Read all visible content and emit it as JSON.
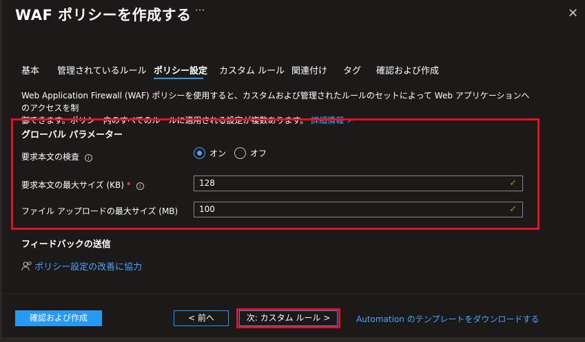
{
  "header": {
    "title": "WAF ポリシーを作成する",
    "more": "···",
    "close": "✕"
  },
  "tabs": [
    {
      "label": "基本",
      "active": false
    },
    {
      "label": "管理されているルール",
      "active": false
    },
    {
      "label": "ポリシー設定",
      "active": true
    },
    {
      "label": "カスタム ルール",
      "active": false
    },
    {
      "label": "関連付け",
      "active": false
    },
    {
      "label": "タグ",
      "active": false
    },
    {
      "label": "確認および作成",
      "active": false
    }
  ],
  "description": {
    "line1": "Web Application Firewall (WAF) ポリシーを使用すると、カスタムおよび管理されたルールのセットによって Web アプリケーションへのアクセスを制",
    "line2": "御できます。ポリシー内のすべてのルールに適用される設定が複数あります。",
    "link": "詳細情報",
    "link_icon": "↗"
  },
  "global_params": {
    "title": "グローバル パラメーター",
    "body_inspection_label": "要求本文の検査",
    "radio_on": "オン",
    "radio_off": "オフ",
    "selected": "オン",
    "max_body_label": "要求本文の最大サイズ (KB)",
    "required_mark": "*",
    "max_body_value": "128",
    "max_upload_label": "ファイル アップロードの最大サイズ (MB)",
    "max_upload_value": "100",
    "check": "✓",
    "info": "i"
  },
  "feedback": {
    "title": "フィードバックの送信",
    "link": "ポリシー設定の改善に協力"
  },
  "footer": {
    "review_button": "確認および作成",
    "prev_button": "< 前へ",
    "next_button": "次: カスタム ルール >",
    "automation_link": "Automation のテンプレートをダウンロードする"
  },
  "colors": {
    "accent": "#2899f5",
    "link": "#4da3ff",
    "highlight": "#e81123",
    "valid": "#6bb700"
  }
}
